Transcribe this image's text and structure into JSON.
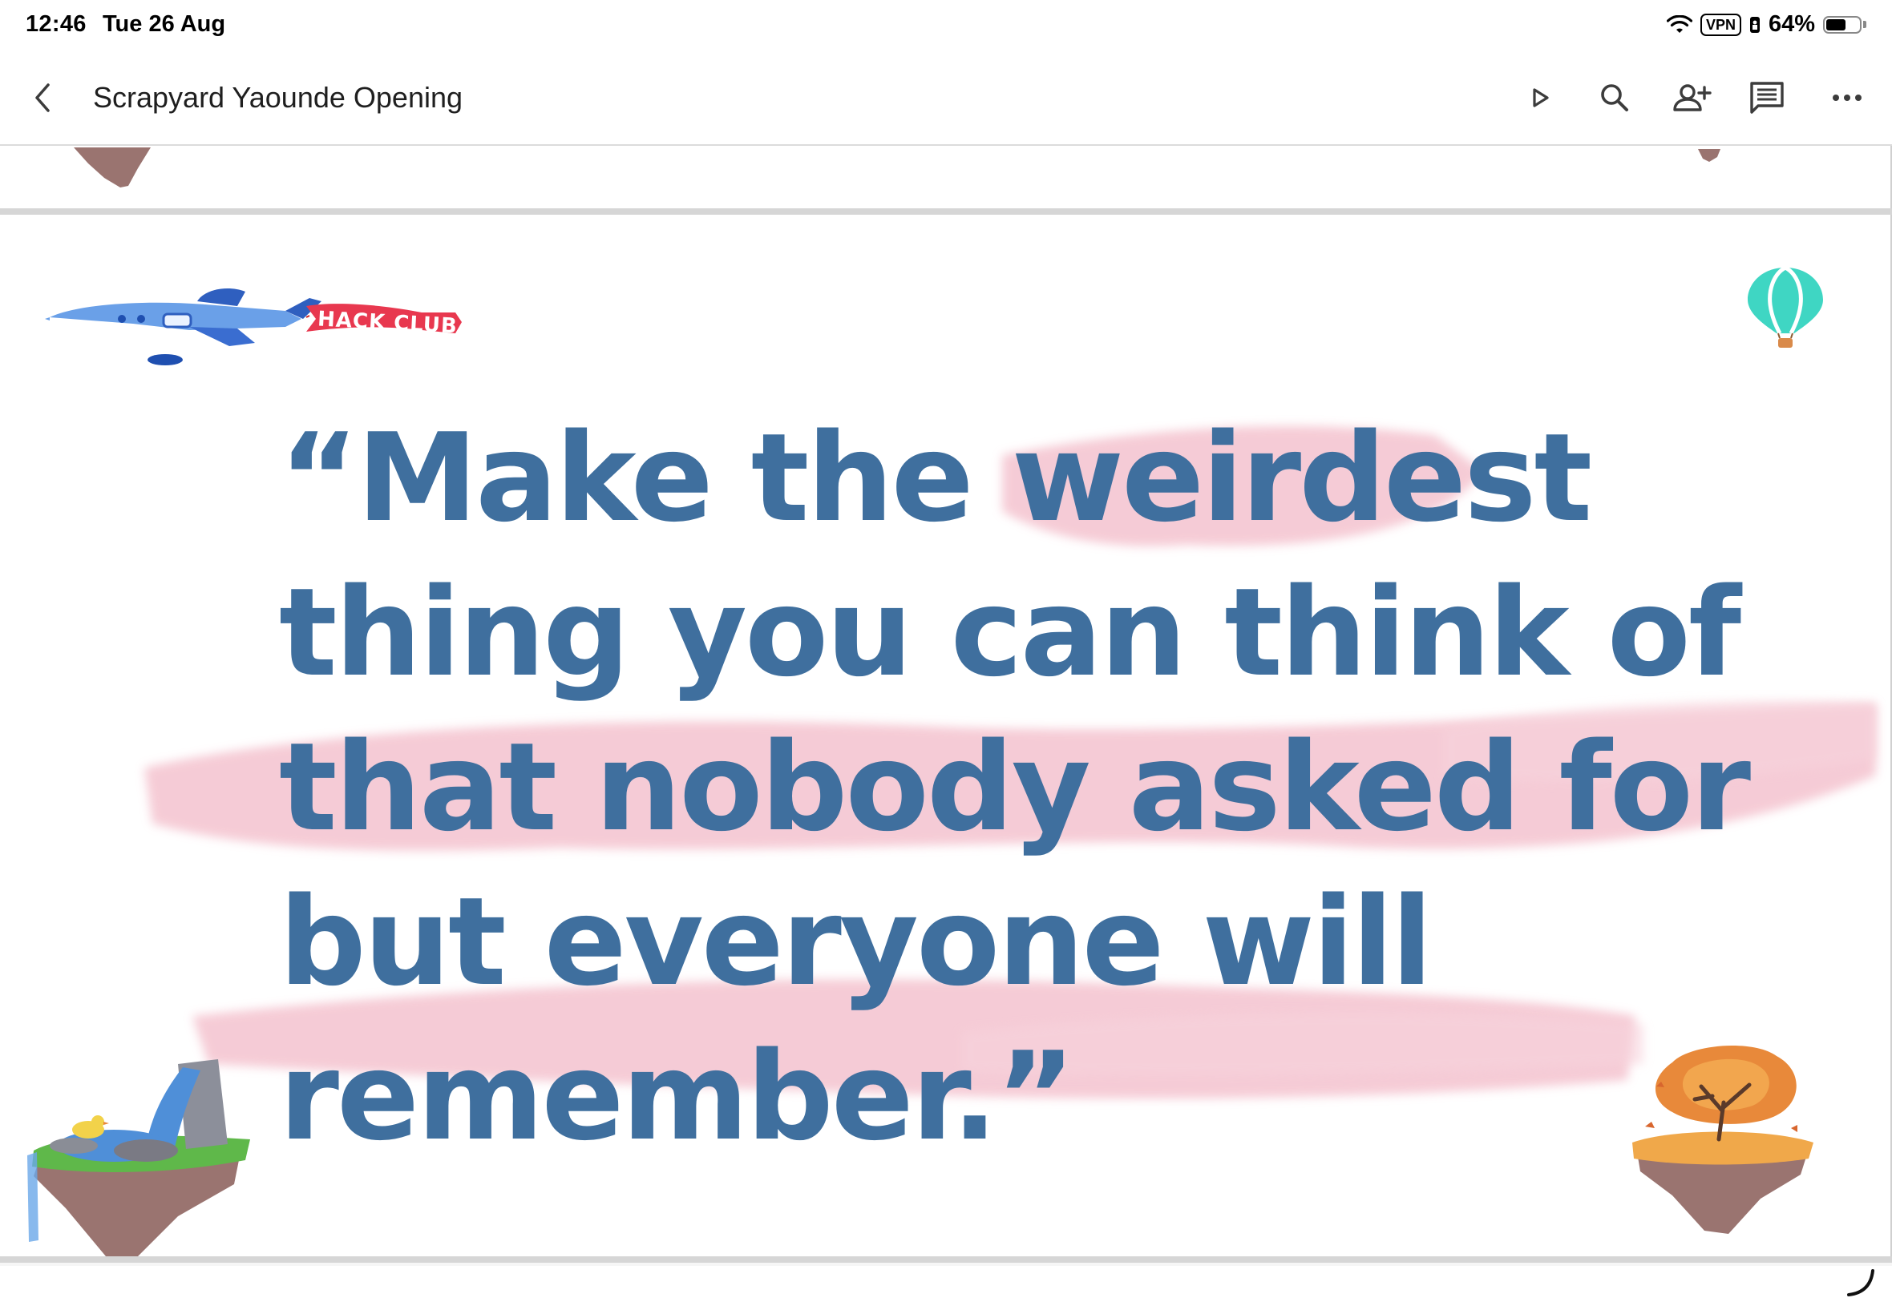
{
  "status_bar": {
    "time": "12:46",
    "date": "Tue 26 Aug",
    "vpn_label": "VPN",
    "battery_percent": "64%",
    "battery_level": 0.64
  },
  "app_bar": {
    "document_title": "Scrapyard Yaounde Opening"
  },
  "toolbar_icons": [
    "back-icon",
    "play-icon",
    "search-icon",
    "share-person-add-icon",
    "comment-icon",
    "more-horizontal-icon"
  ],
  "slide": {
    "banner_text": "HACK CLUB",
    "quote_lines": [
      "“Make the weirdest",
      "thing you can think of",
      "that nobody asked for",
      "but everyone will",
      "remember.”"
    ],
    "colors": {
      "quote_text": "#3f6f9e",
      "brush_stroke": "#f4c3cf",
      "banner": "#e8384f",
      "balloon": "#3fd6c3",
      "plane": "#5b93e0"
    }
  }
}
